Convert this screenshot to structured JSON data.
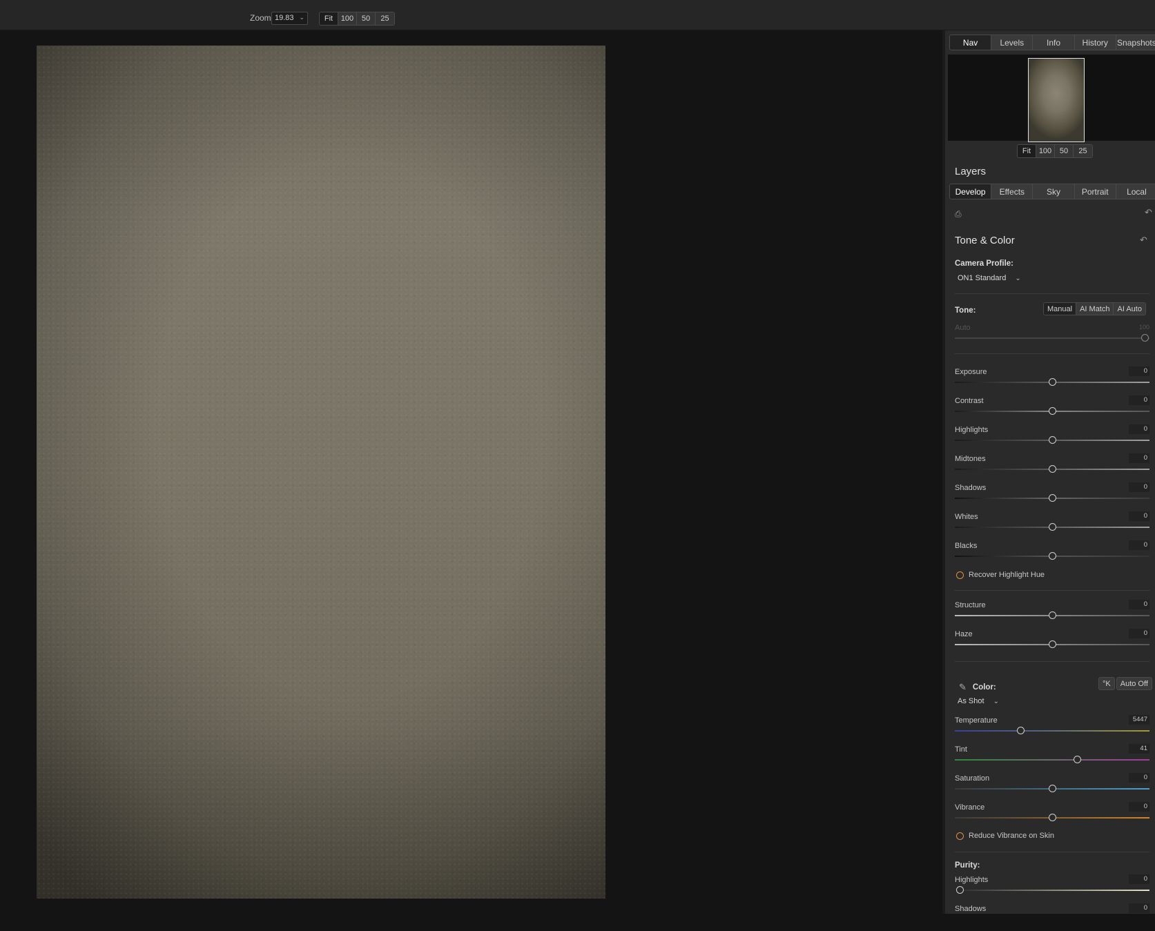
{
  "toolbar": {
    "zoom_label": "Zoom",
    "zoom_value": "19.83",
    "zoom_presets": [
      "Fit",
      "100",
      "50",
      "25"
    ]
  },
  "panel": {
    "nav_tabs": [
      "Nav",
      "Levels",
      "Info",
      "History",
      "Snapshots"
    ],
    "nav_presets": [
      "Fit",
      "100",
      "50",
      "25"
    ],
    "layers_title": "Layers",
    "layer_tabs": [
      "Develop",
      "Effects",
      "Sky",
      "Portrait",
      "Local"
    ],
    "section_title": "Tone & Color",
    "camera_profile_label": "Camera Profile:",
    "camera_profile_value": "ON1 Standard",
    "tone_label": "Tone:",
    "tone_modes": [
      "Manual",
      "AI Match",
      "AI Auto"
    ],
    "auto_label": "Auto",
    "auto_value": "100",
    "tone_sliders": [
      {
        "name": "Exposure",
        "value": "0"
      },
      {
        "name": "Contrast",
        "value": "0"
      },
      {
        "name": "Highlights",
        "value": "0"
      },
      {
        "name": "Midtones",
        "value": "0"
      },
      {
        "name": "Shadows",
        "value": "0"
      },
      {
        "name": "Whites",
        "value": "0"
      },
      {
        "name": "Blacks",
        "value": "0"
      }
    ],
    "recover_highlight_hue": "Recover Highlight Hue",
    "detail_sliders": [
      {
        "name": "Structure",
        "value": "0"
      },
      {
        "name": "Haze",
        "value": "0"
      }
    ],
    "color_label": "Color:",
    "color_buttons": [
      "°K",
      "Auto Off"
    ],
    "white_balance": "As Shot",
    "color_sliders": [
      {
        "name": "Temperature",
        "value": "5447"
      },
      {
        "name": "Tint",
        "value": "41"
      },
      {
        "name": "Saturation",
        "value": "0"
      },
      {
        "name": "Vibrance",
        "value": "0"
      }
    ],
    "reduce_vibrance_on_skin": "Reduce Vibrance on Skin",
    "purity_label": "Purity:",
    "purity_sliders": [
      {
        "name": "Highlights",
        "value": "0"
      },
      {
        "name": "Shadows",
        "value": "0"
      }
    ]
  }
}
